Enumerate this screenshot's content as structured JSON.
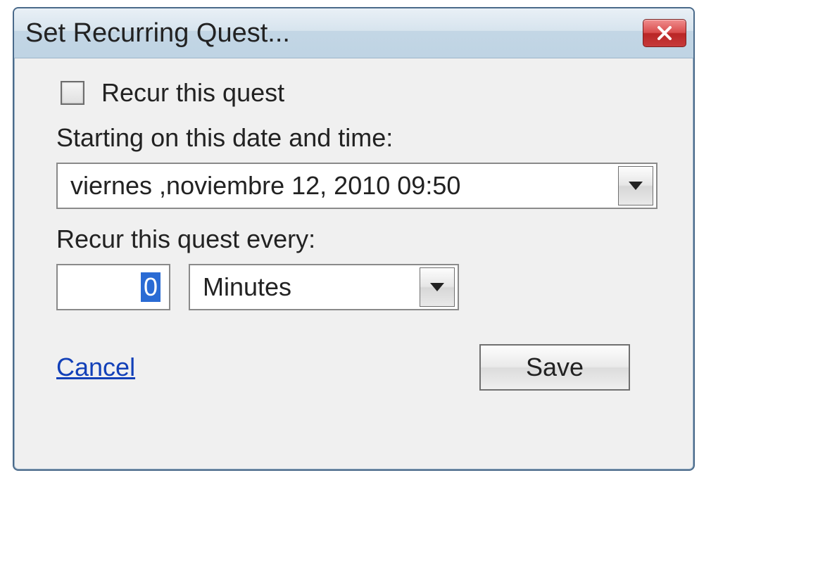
{
  "titlebar": {
    "title": "Set Recurring Quest..."
  },
  "form": {
    "recur_checkbox_label": "Recur this quest",
    "start_label": "Starting on this date and time:",
    "datetime_value": "viernes  ,noviembre 12, 2010 09:50",
    "every_label": "Recur this quest every:",
    "interval_value": "0",
    "unit_value": "Minutes"
  },
  "footer": {
    "cancel": "Cancel",
    "save": "Save"
  }
}
